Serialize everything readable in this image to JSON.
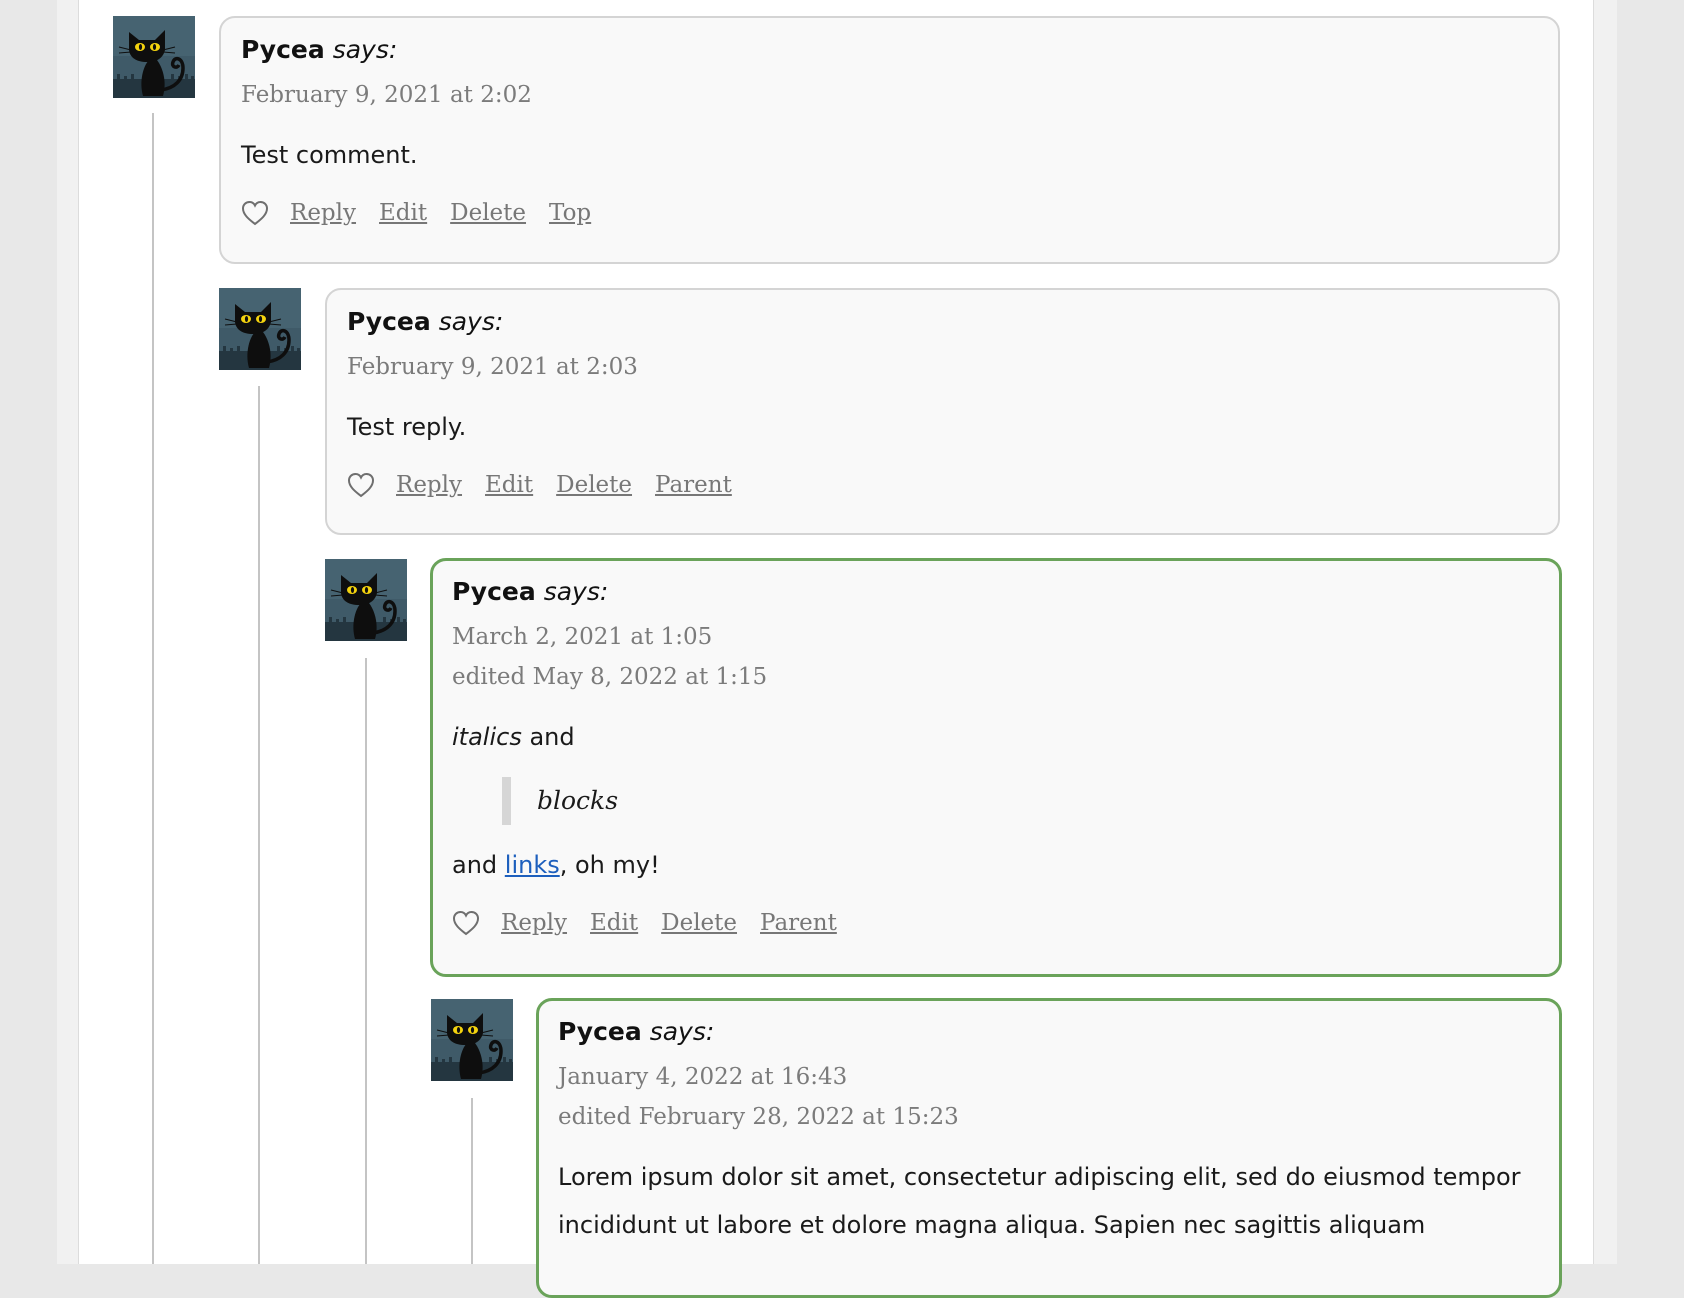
{
  "comments": [
    {
      "author": "Pycea",
      "says": "says:",
      "date": "February 9, 2021 at 2:02",
      "edited": "",
      "paragraph1": "Test comment.",
      "actions": {
        "reply": "Reply",
        "edit": "Edit",
        "delete": "Delete",
        "nav": "Top"
      },
      "highlighted": false
    },
    {
      "author": "Pycea",
      "says": "says:",
      "date": "February 9, 2021 at 2:03",
      "edited": "",
      "paragraph1": "Test reply.",
      "actions": {
        "reply": "Reply",
        "edit": "Edit",
        "delete": "Delete",
        "nav": "Parent"
      },
      "highlighted": false
    },
    {
      "author": "Pycea",
      "says": "says:",
      "date": "March 2, 2021 at 1:05",
      "edited": "edited May 8, 2022 at 1:15",
      "body": {
        "italic_word": "italics",
        "after_italic": " and",
        "quote": "blocks",
        "before_link": "and ",
        "link_text": "links",
        "after_link": ", oh my!"
      },
      "actions": {
        "reply": "Reply",
        "edit": "Edit",
        "delete": "Delete",
        "nav": "Parent"
      },
      "highlighted": true
    },
    {
      "author": "Pycea",
      "says": "says:",
      "date": "January 4, 2022 at 16:43",
      "edited": "edited February 28, 2022 at 15:23",
      "paragraph1": "Lorem ipsum dolor sit amet, consectetur adipiscing elit, sed do eiusmod tempor incididunt ut labore et dolore magna aliqua. Sapien nec sagittis aliquam",
      "highlighted": true
    }
  ],
  "avatar": {
    "icon": "black-cat-avatar"
  },
  "colors": {
    "highlight_border": "#6aa35a",
    "card_border": "#d4d4d4",
    "card_background": "#f9f9f9",
    "link": "#1d5fbd",
    "meta_text": "#7b7b7b"
  }
}
